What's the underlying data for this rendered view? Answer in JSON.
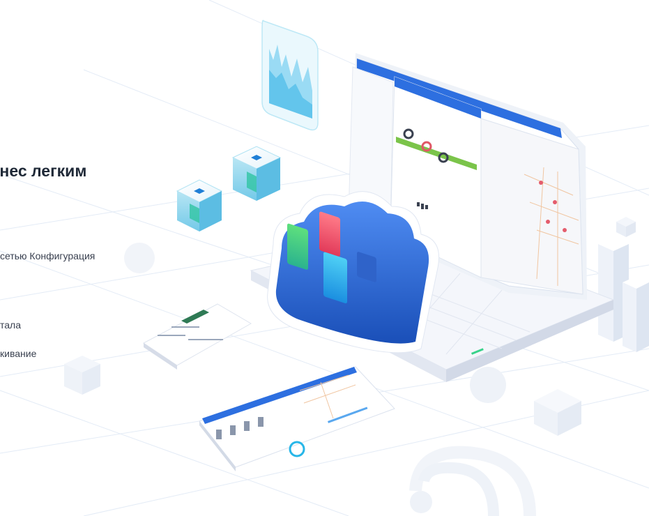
{
  "headline": "знес легким",
  "features": [
    "сетью Конфигурация",
    "тала",
    "кивание"
  ],
  "colors": {
    "primary": "#2d6fe0",
    "cloud": "#1f5fcf",
    "accent_green": "#46c96b",
    "accent_red": "#f0556b",
    "accent_cyan": "#27b6e8",
    "line": "#dfe7f3"
  }
}
